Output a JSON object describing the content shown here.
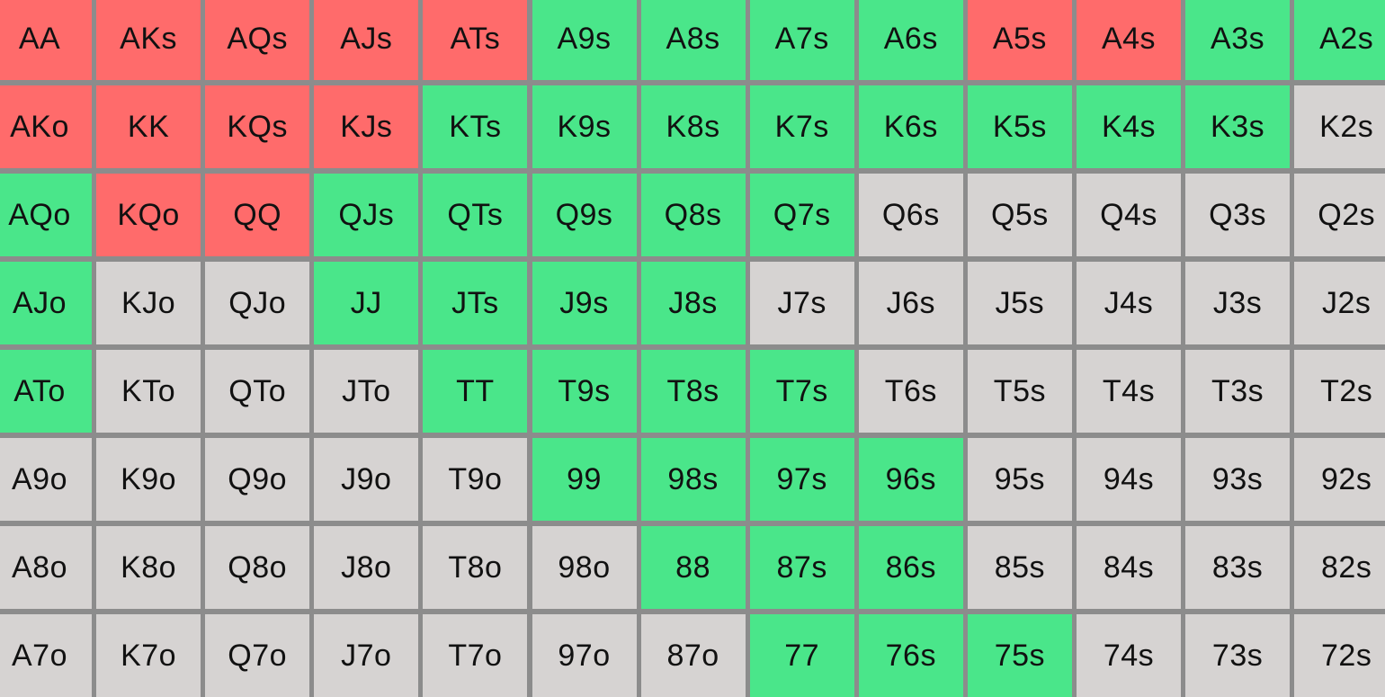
{
  "colors": {
    "raise": "#ff6b6b",
    "call": "#4ae68a",
    "fold": "#d6d3d2",
    "grid_line": "#8c8c8c"
  },
  "rows": [
    {
      "cells": [
        [
          "AA",
          "raise"
        ],
        [
          "AKs",
          "raise"
        ],
        [
          "AQs",
          "raise"
        ],
        [
          "AJs",
          "raise"
        ],
        [
          "ATs",
          "raise"
        ],
        [
          "A9s",
          "call"
        ],
        [
          "A8s",
          "call"
        ],
        [
          "A7s",
          "call"
        ],
        [
          "A6s",
          "call"
        ],
        [
          "A5s",
          "raise"
        ],
        [
          "A4s",
          "raise"
        ],
        [
          "A3s",
          "call"
        ],
        [
          "A2s",
          "call"
        ]
      ]
    },
    {
      "cells": [
        [
          "AKo",
          "raise"
        ],
        [
          "KK",
          "raise"
        ],
        [
          "KQs",
          "raise"
        ],
        [
          "KJs",
          "raise"
        ],
        [
          "KTs",
          "call"
        ],
        [
          "K9s",
          "call"
        ],
        [
          "K8s",
          "call"
        ],
        [
          "K7s",
          "call"
        ],
        [
          "K6s",
          "call"
        ],
        [
          "K5s",
          "call"
        ],
        [
          "K4s",
          "call"
        ],
        [
          "K3s",
          "call"
        ],
        [
          "K2s",
          "fold"
        ]
      ]
    },
    {
      "cells": [
        [
          "AQo",
          "call"
        ],
        [
          "KQo",
          "raise"
        ],
        [
          "QQ",
          "raise"
        ],
        [
          "QJs",
          "call"
        ],
        [
          "QTs",
          "call"
        ],
        [
          "Q9s",
          "call"
        ],
        [
          "Q8s",
          "call"
        ],
        [
          "Q7s",
          "call"
        ],
        [
          "Q6s",
          "fold"
        ],
        [
          "Q5s",
          "fold"
        ],
        [
          "Q4s",
          "fold"
        ],
        [
          "Q3s",
          "fold"
        ],
        [
          "Q2s",
          "fold"
        ]
      ]
    },
    {
      "cells": [
        [
          "AJo",
          "call"
        ],
        [
          "KJo",
          "fold"
        ],
        [
          "QJo",
          "fold"
        ],
        [
          "JJ",
          "call"
        ],
        [
          "JTs",
          "call"
        ],
        [
          "J9s",
          "call"
        ],
        [
          "J8s",
          "call"
        ],
        [
          "J7s",
          "fold"
        ],
        [
          "J6s",
          "fold"
        ],
        [
          "J5s",
          "fold"
        ],
        [
          "J4s",
          "fold"
        ],
        [
          "J3s",
          "fold"
        ],
        [
          "J2s",
          "fold"
        ]
      ]
    },
    {
      "cells": [
        [
          "ATo",
          "call"
        ],
        [
          "KTo",
          "fold"
        ],
        [
          "QTo",
          "fold"
        ],
        [
          "JTo",
          "fold"
        ],
        [
          "TT",
          "call"
        ],
        [
          "T9s",
          "call"
        ],
        [
          "T8s",
          "call"
        ],
        [
          "T7s",
          "call"
        ],
        [
          "T6s",
          "fold"
        ],
        [
          "T5s",
          "fold"
        ],
        [
          "T4s",
          "fold"
        ],
        [
          "T3s",
          "fold"
        ],
        [
          "T2s",
          "fold"
        ]
      ]
    },
    {
      "cells": [
        [
          "A9o",
          "fold"
        ],
        [
          "K9o",
          "fold"
        ],
        [
          "Q9o",
          "fold"
        ],
        [
          "J9o",
          "fold"
        ],
        [
          "T9o",
          "fold"
        ],
        [
          "99",
          "call"
        ],
        [
          "98s",
          "call"
        ],
        [
          "97s",
          "call"
        ],
        [
          "96s",
          "call"
        ],
        [
          "95s",
          "fold"
        ],
        [
          "94s",
          "fold"
        ],
        [
          "93s",
          "fold"
        ],
        [
          "92s",
          "fold"
        ]
      ]
    },
    {
      "cells": [
        [
          "A8o",
          "fold"
        ],
        [
          "K8o",
          "fold"
        ],
        [
          "Q8o",
          "fold"
        ],
        [
          "J8o",
          "fold"
        ],
        [
          "T8o",
          "fold"
        ],
        [
          "98o",
          "fold"
        ],
        [
          "88",
          "call"
        ],
        [
          "87s",
          "call"
        ],
        [
          "86s",
          "call"
        ],
        [
          "85s",
          "fold"
        ],
        [
          "84s",
          "fold"
        ],
        [
          "83s",
          "fold"
        ],
        [
          "82s",
          "fold"
        ]
      ]
    },
    {
      "cells": [
        [
          "A7o",
          "fold"
        ],
        [
          "K7o",
          "fold"
        ],
        [
          "Q7o",
          "fold"
        ],
        [
          "J7o",
          "fold"
        ],
        [
          "T7o",
          "fold"
        ],
        [
          "97o",
          "fold"
        ],
        [
          "87o",
          "fold"
        ],
        [
          "77",
          "call"
        ],
        [
          "76s",
          "call"
        ],
        [
          "75s",
          "call"
        ],
        [
          "74s",
          "fold"
        ],
        [
          "73s",
          "fold"
        ],
        [
          "72s",
          "fold"
        ]
      ]
    }
  ]
}
